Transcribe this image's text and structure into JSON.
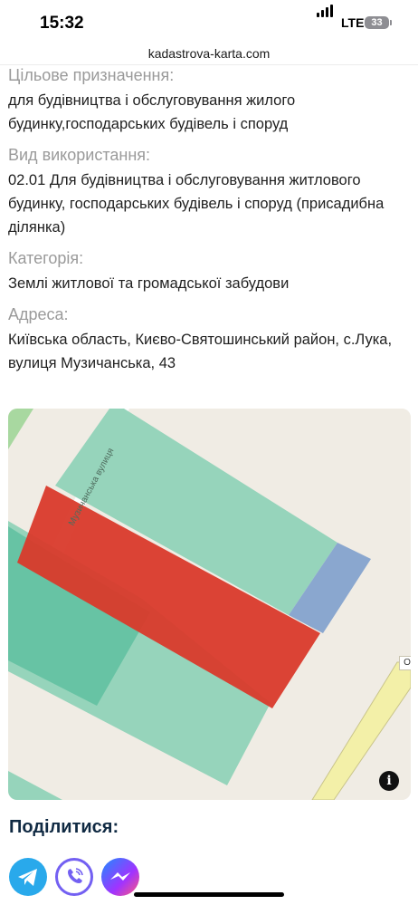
{
  "status": {
    "time": "15:32",
    "network": "LTE",
    "battery": "33"
  },
  "browser": {
    "url": "kadastrova-karta.com"
  },
  "parcel": {
    "purpose_label": "Цільове призначення:",
    "purpose_value": "для будівництва і обслуговування жилого будинку,господарських будівель і споруд",
    "usage_label": "Вид використання:",
    "usage_value": "02.01 Для будівництва і обслуговування житлового будинку, господарських будівель і споруд (присадибна ділянка)",
    "category_label": "Категорія:",
    "category_value": "Землі житлової та громадської забудови",
    "address_label": "Адреса:",
    "address_value": "Київська область, Києво-Святошинський район, с.Лука, вулиця Музичанська, 43"
  },
  "map": {
    "street_label": "Музичанська вулиця",
    "edge_label": "О",
    "info_icon": "info-icon",
    "colors": {
      "highlight": "#d93a2b",
      "parcel": "#96d4bb",
      "parcel_dark": "#67c3a4",
      "parcel_blue": "#8aa7cf",
      "background": "#f0ece4",
      "road": "#f3f0a8"
    }
  },
  "share": {
    "title": "Поділитися:",
    "buttons": [
      {
        "icon": "telegram-icon",
        "color": "#29a9eb"
      },
      {
        "icon": "viber-icon",
        "color": "#7360f2"
      },
      {
        "icon": "messenger-icon",
        "color": "#a033ff"
      }
    ]
  }
}
